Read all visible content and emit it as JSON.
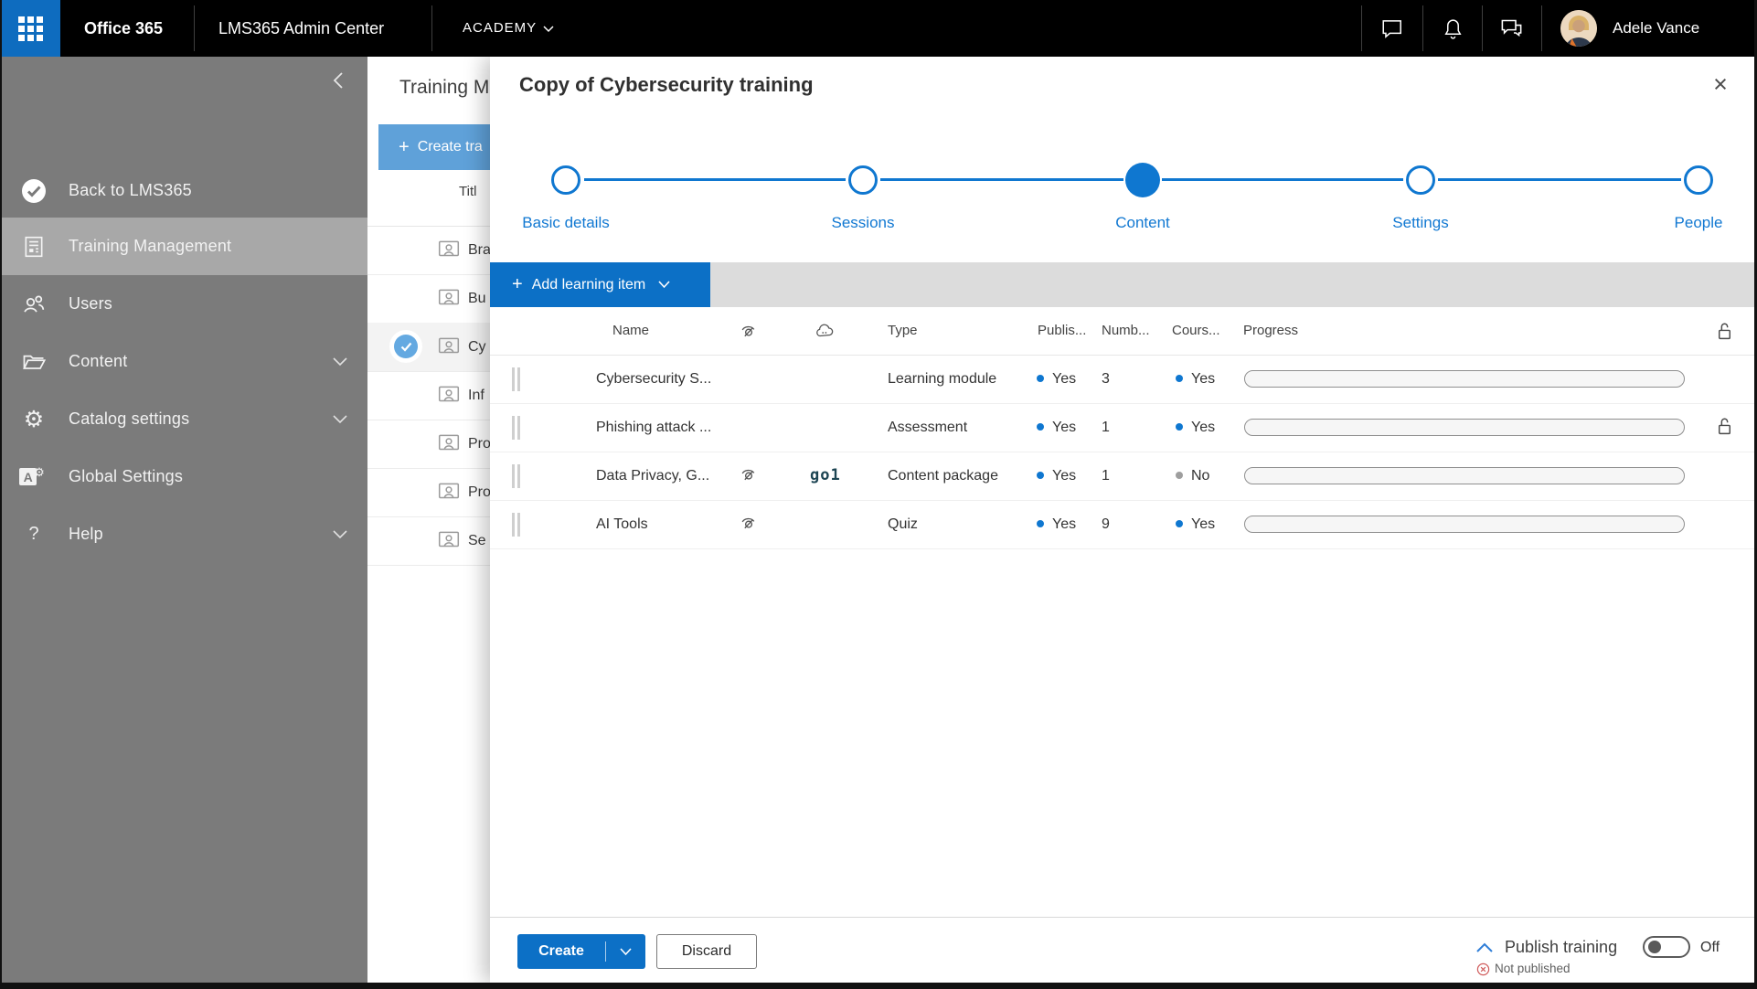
{
  "topbar": {
    "brand": "Office 365",
    "app_title": "LMS365 Admin Center",
    "tenant": "ACADEMY",
    "user_name": "Adele Vance"
  },
  "sidebar": {
    "items": [
      {
        "label": "Back to LMS365"
      },
      {
        "label": "Training Management"
      },
      {
        "label": "Users"
      },
      {
        "label": "Content"
      },
      {
        "label": "Catalog settings"
      },
      {
        "label": "Global Settings"
      },
      {
        "label": "Help"
      }
    ]
  },
  "panel": {
    "title": "Training M",
    "create_label": "Create tra",
    "column_title": "Titl",
    "rows": [
      {
        "label": "Bra"
      },
      {
        "label": "Bu"
      },
      {
        "label": "Cy",
        "selected": true
      },
      {
        "label": "Inf"
      },
      {
        "label": "Pro"
      },
      {
        "label": "Pro"
      },
      {
        "label": "Se"
      }
    ]
  },
  "modal": {
    "title": "Copy of Cybersecurity training",
    "steps": [
      {
        "label": "Basic details",
        "state": "upcoming"
      },
      {
        "label": "Sessions",
        "state": "upcoming"
      },
      {
        "label": "Content",
        "state": "current"
      },
      {
        "label": "Settings",
        "state": "upcoming"
      },
      {
        "label": "People",
        "state": "upcoming"
      }
    ],
    "toolbar": {
      "add_label": "Add learning item"
    },
    "table": {
      "headers": {
        "name": "Name",
        "type": "Type",
        "published": "Publis...",
        "number": "Numb...",
        "course": "Cours...",
        "progress": "Progress"
      },
      "rows": [
        {
          "name": "Cybersecurity S...",
          "type": "Learning module",
          "published": "Yes",
          "number": "3",
          "course": "Yes",
          "progress_percent": 0,
          "locked": false,
          "hidden_from_catalog": false,
          "provider": ""
        },
        {
          "name": "Phishing attack ...",
          "type": "Assessment",
          "published": "Yes",
          "number": "1",
          "course": "Yes",
          "progress_percent": 0,
          "locked": true,
          "hidden_from_catalog": false,
          "provider": ""
        },
        {
          "name": "Data Privacy, G...",
          "type": "Content package",
          "published": "Yes",
          "number": "1",
          "course": "No",
          "progress_percent": 0,
          "locked": false,
          "hidden_from_catalog": true,
          "provider": "go1"
        },
        {
          "name": "AI Tools",
          "type": "Quiz",
          "published": "Yes",
          "number": "9",
          "course": "Yes",
          "progress_percent": 0,
          "locked": false,
          "hidden_from_catalog": true,
          "provider": ""
        }
      ]
    },
    "footer": {
      "create_label": "Create",
      "discard_label": "Discard",
      "publish_label": "Publish training",
      "toggle_state": "Off",
      "status": "Not published"
    }
  },
  "icons": {
    "plus": "+",
    "close": "×",
    "question_mark": "?",
    "gear": "⚙"
  },
  "colors": {
    "accent_blue": "#0c70c6",
    "stepper_blue": "#0f77d0",
    "light_blue_button": "#5fa1d9",
    "selected_check_blue": "#64a9e1",
    "published_dot_blue": "#0f77d0",
    "course_no_dot_gray": "#9e9e9e",
    "status_red": "#d05c5c",
    "topbar_black": "#000000",
    "sidebar_gray": "#7b7b7b"
  }
}
